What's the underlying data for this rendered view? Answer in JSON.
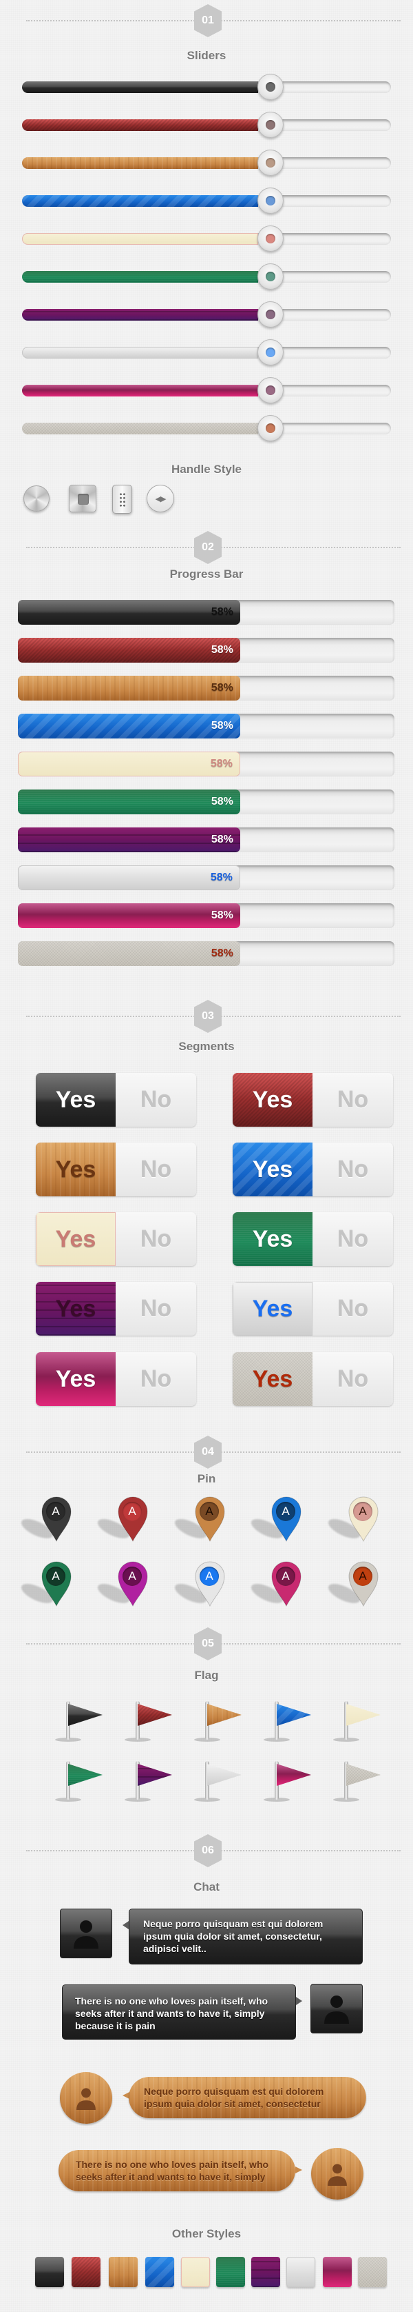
{
  "sections": {
    "s01": {
      "number": "01",
      "title": "Sliders"
    },
    "handle_title": "Handle Style",
    "s02": {
      "number": "02",
      "title": "Progress Bar"
    },
    "s03": {
      "number": "03",
      "title": "Segments"
    },
    "s04": {
      "number": "04",
      "title": "Pin"
    },
    "s05": {
      "number": "05",
      "title": "Flag"
    },
    "s06": {
      "number": "06",
      "title": "Chat"
    },
    "other_title": "Other Styles"
  },
  "themes": [
    "black",
    "red",
    "wood",
    "blue",
    "paper",
    "green",
    "purple",
    "silver",
    "pink",
    "linen"
  ],
  "sliders": [
    {
      "theme": "black",
      "value": 0.64,
      "knob_color": "#6a6a6a"
    },
    {
      "theme": "red",
      "value": 0.64,
      "knob_color": "#8e7474"
    },
    {
      "theme": "wood",
      "value": 0.64,
      "knob_color": "#b99a86"
    },
    {
      "theme": "blue",
      "value": 0.64,
      "knob_color": "#6a9ad8"
    },
    {
      "theme": "paper",
      "value": 0.64,
      "knob_color": "#d98880"
    },
    {
      "theme": "green",
      "value": 0.64,
      "knob_color": "#5e9a88"
    },
    {
      "theme": "purple",
      "value": 0.64,
      "knob_color": "#8a6a82"
    },
    {
      "theme": "silver",
      "value": 0.64,
      "knob_color": "#6aa8f4"
    },
    {
      "theme": "pink",
      "value": 0.64,
      "knob_color": "#9a6a84"
    },
    {
      "theme": "linen",
      "value": 0.64,
      "knob_color": "#c87a5a"
    }
  ],
  "handle_styles": [
    "round-brushed-knob",
    "square-brushed-knob",
    "grip-dots-knob",
    "arrows-knob"
  ],
  "progress": [
    {
      "theme": "black",
      "percent": 58,
      "label": "58%",
      "label_color": "#111111"
    },
    {
      "theme": "red",
      "percent": 58,
      "label": "58%",
      "label_color": "#ffffff"
    },
    {
      "theme": "wood",
      "percent": 58,
      "label": "58%",
      "label_color": "#5a2e10"
    },
    {
      "theme": "blue",
      "percent": 58,
      "label": "58%",
      "label_color": "#ffffff"
    },
    {
      "theme": "paper",
      "percent": 58,
      "label": "58%",
      "label_color": "#d08a82"
    },
    {
      "theme": "green",
      "percent": 58,
      "label": "58%",
      "label_color": "#ffffff"
    },
    {
      "theme": "purple",
      "percent": 58,
      "label": "58%",
      "label_color": "#ffffff"
    },
    {
      "theme": "silver",
      "percent": 58,
      "label": "58%",
      "label_color": "#1a63e0"
    },
    {
      "theme": "pink",
      "percent": 58,
      "label": "58%",
      "label_color": "#ffffff"
    },
    {
      "theme": "linen",
      "percent": 58,
      "label": "58%",
      "label_color": "#a02a10"
    }
  ],
  "segments": [
    {
      "theme": "black",
      "yes": "Yes",
      "no": "No",
      "yes_color": "#ffffff"
    },
    {
      "theme": "red",
      "yes": "Yes",
      "no": "No",
      "yes_color": "#ffffff"
    },
    {
      "theme": "wood",
      "yes": "Yes",
      "no": "No",
      "yes_color": "#6b3512"
    },
    {
      "theme": "blue",
      "yes": "Yes",
      "no": "No",
      "yes_color": "#ffffff"
    },
    {
      "theme": "paper",
      "yes": "Yes",
      "no": "No",
      "yes_color": "#c97b74"
    },
    {
      "theme": "green",
      "yes": "Yes",
      "no": "No",
      "yes_color": "#ffffff"
    },
    {
      "theme": "purple",
      "yes": "Yes",
      "no": "No",
      "yes_color": "#3a0a2a"
    },
    {
      "theme": "silver",
      "yes": "Yes",
      "no": "No",
      "yes_color": "#1a6ef0"
    },
    {
      "theme": "pink",
      "yes": "Yes",
      "no": "No",
      "yes_color": "#ffffff"
    },
    {
      "theme": "linen",
      "yes": "Yes",
      "no": "No",
      "yes_color": "#b02a0a"
    }
  ],
  "pins": [
    {
      "theme": "black",
      "letter": "A",
      "inner": "#2a2a2a",
      "letter_color": "#ffffff"
    },
    {
      "theme": "red",
      "letter": "A",
      "inner": "#c0393a",
      "letter_color": "#ffffff"
    },
    {
      "theme": "wood",
      "letter": "A",
      "inner": "#7a4a25",
      "letter_color": "#1a0a00"
    },
    {
      "theme": "blue",
      "letter": "A",
      "inner": "#0f3f70",
      "letter_color": "#ffffff"
    },
    {
      "theme": "paper",
      "letter": "A",
      "inner": "#d69a92",
      "letter_color": "#3a1a10"
    },
    {
      "theme": "green",
      "letter": "A",
      "inner": "#123a28",
      "letter_color": "#ffffff"
    },
    {
      "theme": "purple",
      "letter": "A",
      "inner": "#6a1050",
      "letter_color": "#ffffff"
    },
    {
      "theme": "silver",
      "letter": "A",
      "inner": "#1a78f0",
      "letter_color": "#ffffff"
    },
    {
      "theme": "pink",
      "letter": "A",
      "inner": "#7a1848",
      "letter_color": "#ffffff"
    },
    {
      "theme": "linen",
      "letter": "A",
      "inner": "#c04010",
      "letter_color": "#2a0a00"
    }
  ],
  "flags": [
    "black",
    "red",
    "wood",
    "blue",
    "paper",
    "green",
    "purple",
    "silver",
    "pink",
    "linen"
  ],
  "chat": {
    "dark": [
      {
        "side": "left",
        "text": "Neque porro quisquam est qui dolorem ipsum quia dolor sit amet, consectetur, adipisci velit.."
      },
      {
        "side": "right",
        "text": "There is no one who loves pain itself, who seeks after it and wants to have it, simply because it is pain"
      }
    ],
    "wood": [
      {
        "side": "left",
        "text": "Neque porro quisquam est qui dolorem ipsum quia dolor sit amet, consectetur"
      },
      {
        "side": "right",
        "text": "There is no one who loves pain itself, who seeks after it and wants to have it, simply"
      }
    ]
  },
  "other_styles": [
    "black",
    "red",
    "wood",
    "blue",
    "paper",
    "green",
    "purple",
    "silver",
    "pink",
    "linen"
  ]
}
